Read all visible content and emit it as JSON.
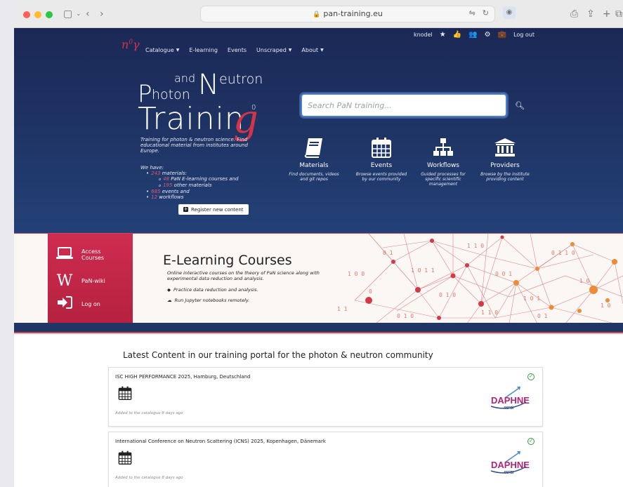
{
  "browser": {
    "url": "pan-training.eu"
  },
  "nav": {
    "items": [
      {
        "label": "Catalogue",
        "caret": true
      },
      {
        "label": "E-learning",
        "caret": false
      },
      {
        "label": "Events",
        "caret": false
      },
      {
        "label": "Unscraped",
        "caret": true
      },
      {
        "label": "About",
        "caret": true
      }
    ],
    "user": "knodel",
    "logout": "Log out"
  },
  "hero": {
    "title_and": "and",
    "title_n": "N",
    "title_eutron": "eutron",
    "title_p": "P",
    "title_hoton": "hoton",
    "title_trainin": "Trainin",
    "title_g": "g",
    "title_sup": "0",
    "tagline": "Training for photon & neutron science. Find educational material from institutes around Europe.",
    "we_have_label": "We have:",
    "materials_count": "243",
    "materials_label": " materials:",
    "elearning_count": "48",
    "elearning_label": " PaN E-learning courses and",
    "other_count": "195",
    "other_label": " other materials",
    "events_count": "685",
    "events_label": " events and",
    "workflows_count": "12",
    "workflows_label": " workflows",
    "register_label": "Register new content",
    "search_placeholder": "Search PaN training...",
    "categories": [
      {
        "title": "Materials",
        "desc": "Find documents, videos and git repos",
        "icon": "book-icon"
      },
      {
        "title": "Events",
        "desc": "Browse events provided by our community",
        "icon": "calendar-icon"
      },
      {
        "title": "Workflows",
        "desc": "Guided processes for specific scientific management",
        "icon": "sitemap-icon"
      },
      {
        "title": "Providers",
        "desc": "Browse by the institute providing content",
        "icon": "institution-icon"
      }
    ]
  },
  "elearning": {
    "sidebar": [
      {
        "label": "Access Courses",
        "icon": "laptop-icon"
      },
      {
        "label": "PaN-wiki",
        "icon": "wikipedia-icon"
      },
      {
        "label": "Log on",
        "icon": "sign-in-icon"
      }
    ],
    "title": "E-Learning Courses",
    "desc": "Online interactive courses on the theory of PaN science along with experimental data reduction and analysis.",
    "bullet1": "Practice data reduction and analysis.",
    "bullet2": "Run Jupyter notebooks remotely."
  },
  "latest": {
    "title": "Latest Content in our training portal for the photon & neutron community",
    "cards": [
      {
        "title": "ISC HIGH PERFORMANCE 2025, Hamburg, Deutschland",
        "added": "Added to the catalogue 8 days ago",
        "provider": "DAPHNE",
        "provider_sub": "4NFDI"
      },
      {
        "title": "International Conference on Neutron Scattering (ICNS) 2025, Kopenhagen, Dänemark",
        "added": "Added to the catalogue 8 days ago",
        "provider": "DAPHNE",
        "provider_sub": "4NFDI"
      }
    ]
  }
}
